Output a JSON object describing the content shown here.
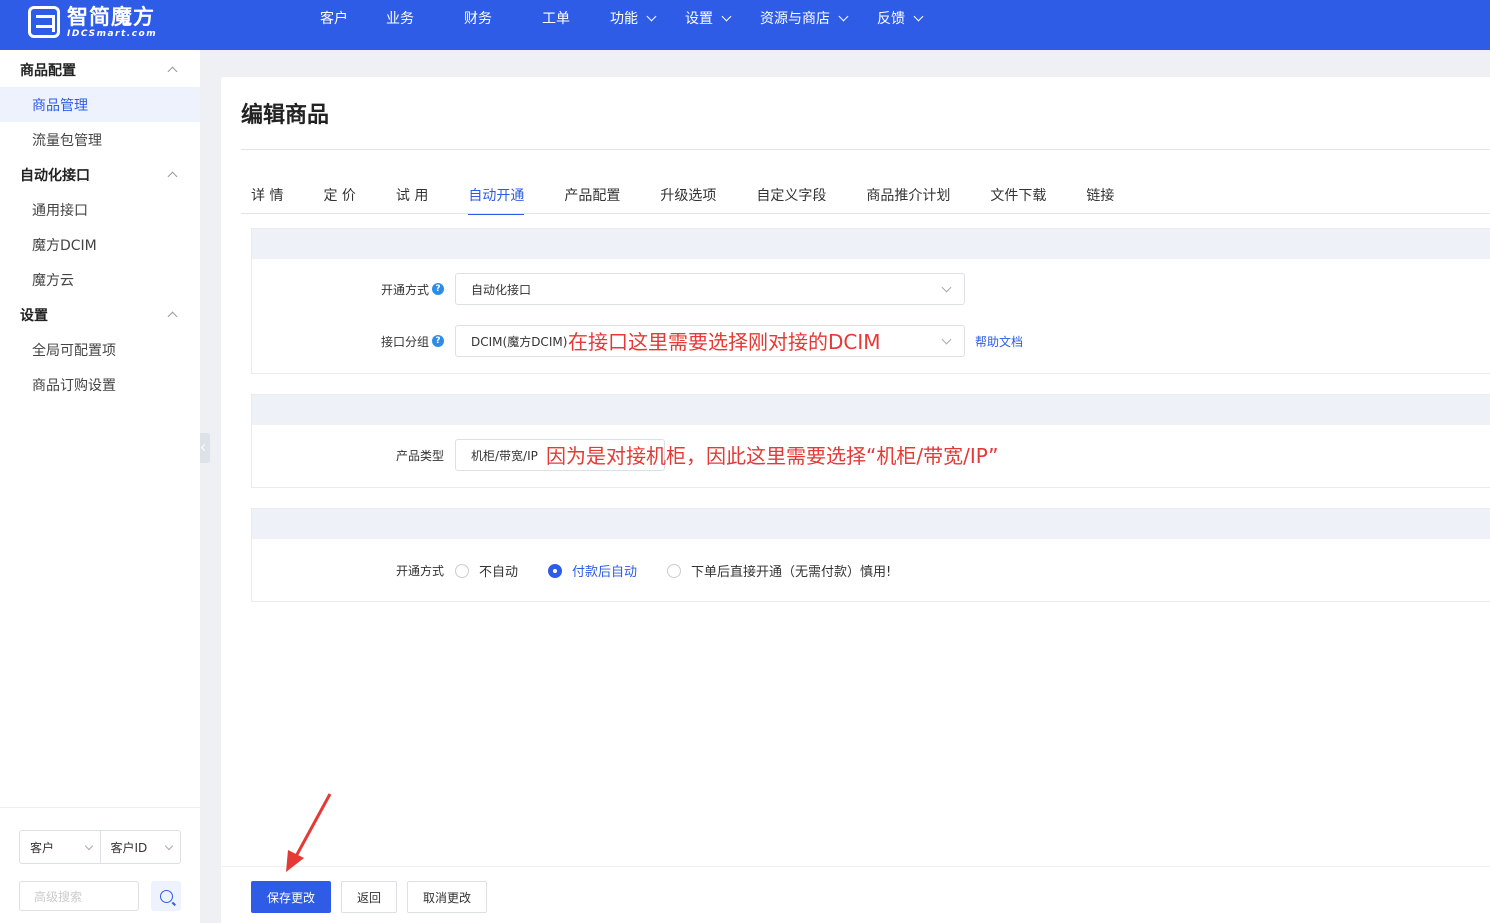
{
  "brand": {
    "name_cn": "智简魔方",
    "name_en": "IDCSmart.com"
  },
  "nav": [
    {
      "label": "客户",
      "has_dropdown": false
    },
    {
      "label": "业务",
      "has_dropdown": false
    },
    {
      "label": "财务",
      "has_dropdown": false
    },
    {
      "label": "工单",
      "has_dropdown": false
    },
    {
      "label": "功能",
      "has_dropdown": true
    },
    {
      "label": "设置",
      "has_dropdown": true
    },
    {
      "label": "资源与商店",
      "has_dropdown": true
    },
    {
      "label": "反馈",
      "has_dropdown": true
    }
  ],
  "sidebar": {
    "groups": [
      {
        "title": "商品配置",
        "items": [
          "商品管理",
          "流量包管理"
        ]
      },
      {
        "title": "自动化接口",
        "items": [
          "通用接口",
          "魔方DCIM",
          "魔方云"
        ]
      },
      {
        "title": "设置",
        "items": [
          "全局可配置项",
          "商品订购设置"
        ]
      }
    ],
    "active_item": "商品管理",
    "search": {
      "type_select": "客户",
      "field_select": "客户ID",
      "placeholder": "高级搜索"
    }
  },
  "page": {
    "title": "编辑商品",
    "tabs": [
      "详 情",
      "定 价",
      "试 用",
      "自动开通",
      "产品配置",
      "升级选项",
      "自定义字段",
      "商品推介计划",
      "文件下载",
      "链接"
    ],
    "active_tab": "自动开通"
  },
  "section1": {
    "open_method_label": "开通方式",
    "open_method_value": "自动化接口",
    "interface_group_label": "接口分组",
    "interface_group_value": "DCIM(魔方DCIM)",
    "help_link": "帮助文档",
    "annotation": "在接口这里需要选择刚对接的DCIM"
  },
  "section2": {
    "product_type_label": "产品类型",
    "product_type_value": "机柜/带宽/IP",
    "annotation": "因为是对接机柜，因此这里需要选择“机柜/带宽/IP”"
  },
  "section3": {
    "open_method_label": "开通方式",
    "options": [
      "不自动",
      "付款后自动",
      "下单后直接开通（无需付款）慎用!"
    ],
    "selected": "付款后自动"
  },
  "footer": {
    "save": "保存更改",
    "back": "返回",
    "cancel": "取消更改"
  },
  "colors": {
    "primary": "#2e5ce6",
    "annotation": "#e53935"
  }
}
